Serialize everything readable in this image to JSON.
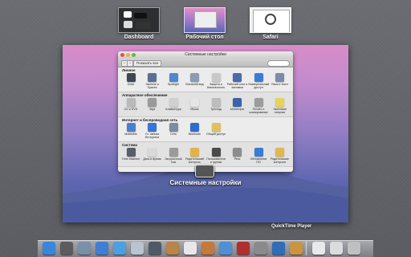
{
  "spaces": [
    {
      "label": "Dashboard"
    },
    {
      "label": "Рабочий стол"
    },
    {
      "label": "Safari"
    }
  ],
  "prefs_window": {
    "title": "Системные настройки",
    "show_all": "Показать все",
    "sections": [
      {
        "title": "Личное",
        "items": [
          {
            "label": "Dock",
            "color": "#3f4652"
          },
          {
            "label": "Экспозе и Spaces",
            "color": "#5a6f94"
          },
          {
            "label": "Spotlight",
            "color": "#4d87d0"
          },
          {
            "label": "Внешний вид",
            "color": "#8a9bb3"
          },
          {
            "label": "Защита и безопасность",
            "color": "#c9c9c9"
          },
          {
            "label": "Рабочий стол и заставка",
            "color": "#4c6aa8"
          },
          {
            "label": "Универсальный доступ",
            "color": "#3a7ed4"
          },
          {
            "label": "Язык и текст",
            "color": "#7c8ca8"
          }
        ]
      },
      {
        "title": "Аппаратное обеспечение",
        "items": [
          {
            "label": "CD и DVD",
            "color": "#b9b9b9"
          },
          {
            "label": "Звук",
            "color": "#9a9a9a"
          },
          {
            "label": "Клавиатура",
            "color": "#d0d0d0"
          },
          {
            "label": "Мышь",
            "color": "#e5e5e5"
          },
          {
            "label": "Трекпад",
            "color": "#bdbdbd"
          },
          {
            "label": "Мониторы",
            "color": "#3a63a8"
          },
          {
            "label": "Печать и сканирование",
            "color": "#9c9c9c"
          },
          {
            "label": "Экономия энергии",
            "color": "#e7d35a"
          }
        ]
      },
      {
        "title": "Интернет и беспроводная сеть",
        "items": [
          {
            "label": "MobileMe",
            "color": "#4a7fd0"
          },
          {
            "label": "Уч. записи Интернета",
            "color": "#3576d6"
          },
          {
            "label": "Сеть",
            "color": "#7a8ba2"
          },
          {
            "label": "Bluetooth",
            "color": "#2f6cd0"
          },
          {
            "label": "Общий доступ",
            "color": "#e0c060"
          }
        ]
      },
      {
        "title": "Система",
        "items": [
          {
            "label": "Time Machine",
            "color": "#555e6b"
          },
          {
            "label": "Дата и время",
            "color": "#d9d9d9"
          },
          {
            "label": "Загрузочный том",
            "color": "#9b9b9b"
          },
          {
            "label": "Родительский контроль",
            "color": "#e1b44a"
          },
          {
            "label": "Пользователи и группы",
            "color": "#4a4a4a"
          },
          {
            "label": "Речь",
            "color": "#8c8c8c"
          },
          {
            "label": "Обновление ПО",
            "color": "#3b7bd2"
          },
          {
            "label": "Родительские контроли",
            "color": "#e1b84d"
          }
        ]
      }
    ]
  },
  "window_label": "Системные настройки",
  "dock": {
    "hover_label": "QuickTime Player",
    "icons": [
      {
        "name": "finder-icon",
        "color": "#3a86d8"
      },
      {
        "name": "dashboard-icon",
        "color": "#5c5c5c"
      },
      {
        "name": "launchpad-icon",
        "color": "#7b8fa8"
      },
      {
        "name": "app-store-icon",
        "color": "#3f7fd3"
      },
      {
        "name": "safari-icon",
        "color": "#4aa0e0"
      },
      {
        "name": "mail-icon",
        "color": "#b9c4cf"
      },
      {
        "name": "facetime-icon",
        "color": "#4f5a66"
      },
      {
        "name": "address-book-icon",
        "color": "#b7844a"
      },
      {
        "name": "calendar-icon",
        "color": "#e8e8e8"
      },
      {
        "name": "photos-icon",
        "color": "#c47a3c"
      },
      {
        "name": "itunes-icon",
        "color": "#4f8fd6"
      },
      {
        "name": "photo-booth-icon",
        "color": "#b02f2f"
      },
      {
        "name": "system-preferences-icon",
        "color": "#8a8a8a"
      },
      {
        "name": "quicktime-icon",
        "color": "#2f6db8"
      },
      {
        "name": "archive-icon",
        "color": "#c9953f"
      },
      {
        "name": "documents-icon",
        "color": "#e9e9e9"
      },
      {
        "name": "downloads-icon",
        "color": "#dcdcdc"
      },
      {
        "name": "trash-icon",
        "color": "#c0c0c0"
      }
    ]
  }
}
